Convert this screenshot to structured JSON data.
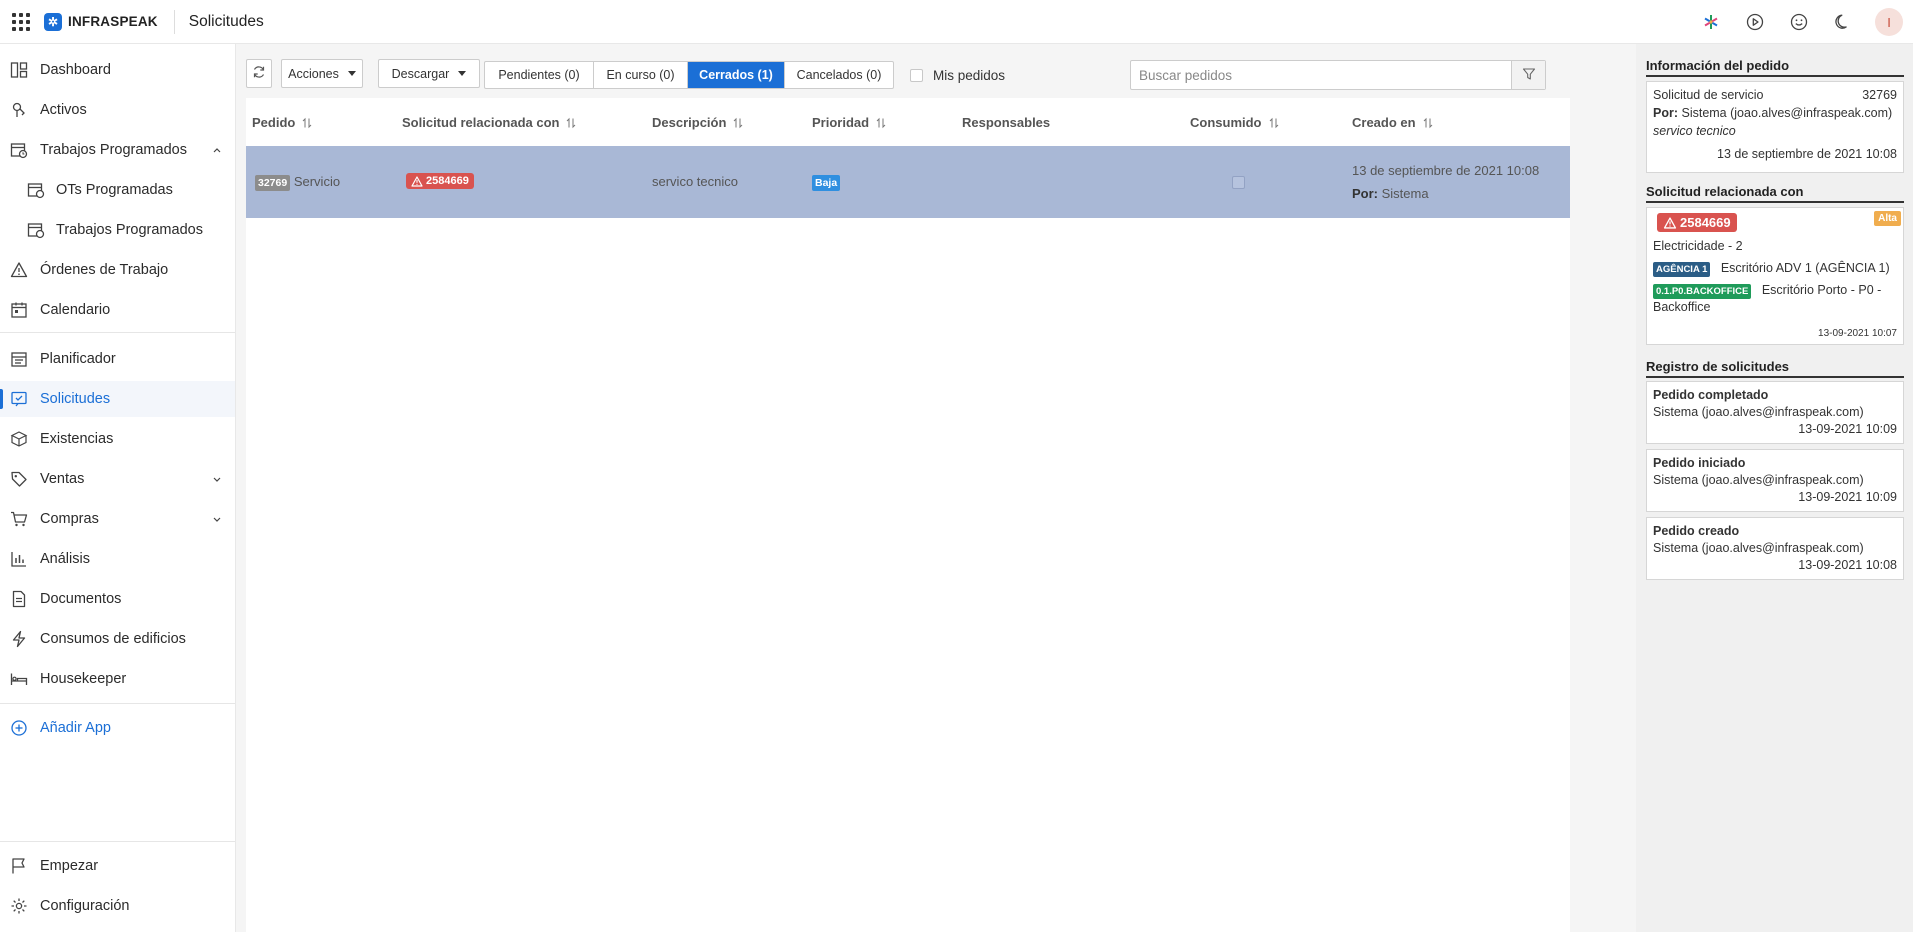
{
  "topbar": {
    "brand": "INFRASPEAK",
    "title": "Solicitudes",
    "avatar_letter": "I",
    "icons": [
      "apps-grid-icon",
      "sparkle-icon",
      "play-icon",
      "smiley-icon",
      "moon-icon"
    ]
  },
  "sidebar": {
    "items": [
      {
        "label": "Dashboard",
        "icon": "dashboard-icon"
      },
      {
        "label": "Activos",
        "icon": "pin-icon"
      },
      {
        "label": "Trabajos Programados",
        "icon": "calendar-clock-icon",
        "expanded": true
      },
      {
        "label": "OTs Programadas",
        "icon": "calendar-clock-icon"
      },
      {
        "label": "Trabajos Programados",
        "icon": "calendar-clock-icon"
      },
      {
        "label": "Órdenes de Trabajo",
        "icon": "warning-icon"
      },
      {
        "label": "Calendario",
        "icon": "calendar-icon"
      },
      {
        "label": "Planificador",
        "icon": "planner-icon"
      },
      {
        "label": "Solicitudes",
        "icon": "request-icon",
        "active": true
      },
      {
        "label": "Existencias",
        "icon": "boxes-icon"
      },
      {
        "label": "Ventas",
        "icon": "tag-icon"
      },
      {
        "label": "Compras",
        "icon": "cart-icon"
      },
      {
        "label": "Análisis",
        "icon": "chart-icon"
      },
      {
        "label": "Documentos",
        "icon": "document-icon"
      },
      {
        "label": "Consumos de edificios",
        "icon": "bolt-icon"
      },
      {
        "label": "Housekeeper",
        "icon": "bed-icon"
      }
    ],
    "add_app": "Añadir App",
    "bottom": [
      {
        "label": "Empezar",
        "icon": "flag-icon"
      },
      {
        "label": "Configuración",
        "icon": "gear-icon"
      }
    ]
  },
  "toolbar": {
    "acciones": "Acciones",
    "descargar": "Descargar",
    "tabs": [
      "Pendientes (0)",
      "En curso (0)",
      "Cerrados (1)",
      "Cancelados (0)"
    ],
    "active_tab": 2,
    "mis_pedidos": "Mis pedidos",
    "search_placeholder": "Buscar pedidos"
  },
  "table": {
    "columns": [
      "Pedido",
      "Solicitud relacionada con",
      "Descripción",
      "Prioridad",
      "Responsables",
      "Consumido",
      "Creado en"
    ],
    "rows": [
      {
        "pedido_id": "32769",
        "pedido_tipo": "Servicio",
        "solicitud": "2584669",
        "descripcion": "servico tecnico",
        "prioridad": "Baja",
        "responsables": "",
        "consumido": false,
        "creado_fecha": "13 de septiembre de 2021 10:08",
        "creado_por_label": "Por:",
        "creado_por": "Sistema"
      }
    ]
  },
  "info_panel": {
    "title": "Información del pedido",
    "tipo": "Solicitud de servicio",
    "id": "32769",
    "por_label": "Por:",
    "por": "Sistema (joao.alves@infraspeak.com)",
    "descripcion": "servico tecnico",
    "fecha": "13 de septiembre de 2021 10:08"
  },
  "related_panel": {
    "title": "Solicitud relacionada con",
    "id": "2584669",
    "priority": "Alta",
    "name": "Electricidade - 2",
    "tag1": "AGÊNCIA 1",
    "loc1": "Escritório ADV 1 (AGÊNCIA 1)",
    "tag2": "0.1.P0.BACKOFFICE",
    "loc2a": "Escritório Porto - P0 -",
    "loc2b": "Backoffice",
    "date": "13-09-2021 10:07"
  },
  "log_panel": {
    "title": "Registro de solicitudes",
    "entries": [
      {
        "title": "Pedido completado",
        "by": "Sistema (joao.alves@infraspeak.com)",
        "date": "13-09-2021 10:09"
      },
      {
        "title": "Pedido iniciado",
        "by": "Sistema (joao.alves@infraspeak.com)",
        "date": "13-09-2021 10:09"
      },
      {
        "title": "Pedido creado",
        "by": "Sistema (joao.alves@infraspeak.com)",
        "date": "13-09-2021 10:08"
      }
    ]
  },
  "colors": {
    "accent": "#1b6fd6",
    "selected_row": "#a9b8d6",
    "danger": "#d9534f",
    "priority_low": "#2f8fe0",
    "priority_high": "#f0ad4e"
  }
}
